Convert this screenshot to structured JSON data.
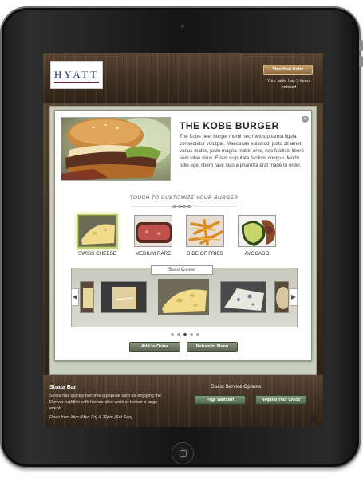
{
  "header": {
    "logo_text": "HYATT",
    "view_order_label": "View Your Order",
    "order_status": "Your table has 3 items ordered"
  },
  "item": {
    "title": "THE KOBE BURGER",
    "description": "The Kobe beef burger morbi nec metus phareta ligula consectetur volutpat. Maecenas euismod, justo sit amet varius mattis, justo magna mattis eros, nec facilisis libero sem vitae risus. Etiam vulputate facilisis congue. Morbi odio eget libero fauc ibus a pharetra erat made to order."
  },
  "customize": {
    "prompt": "TOUCH TO CUSTOMIZE YOUR BURGER",
    "options": [
      {
        "label": "SWISS CHEESE",
        "selected": true
      },
      {
        "label": "MEDIUM RARE",
        "selected": false
      },
      {
        "label": "SIDE OF FRIES",
        "selected": false
      },
      {
        "label": "AVOCADO",
        "selected": false
      }
    ]
  },
  "carousel": {
    "title": "Swiss Cheese",
    "pages": 5,
    "active_page": 3
  },
  "actions": {
    "add_to_order": "Add to Order",
    "return_to_menu": "Return to Menu"
  },
  "footer": {
    "venue_name": "Strata Bar",
    "venue_desc": "Strata has quickly become a popular spot for enjoying the Denver nightlife with friends after work or before a large event.",
    "hours": "Open from 3pm (Mon-Fri) & 12pm (Sat-Sun)",
    "guest_services_title": "Guest Service Options",
    "page_waitstaff": "Page Waitstaff",
    "request_check": "Request Your Check"
  },
  "colors": {
    "wood_dark": "#3e2f22",
    "gold_button": "#b28b56",
    "green_button": "#5a6250",
    "selection_glow": "#c4d07a"
  }
}
